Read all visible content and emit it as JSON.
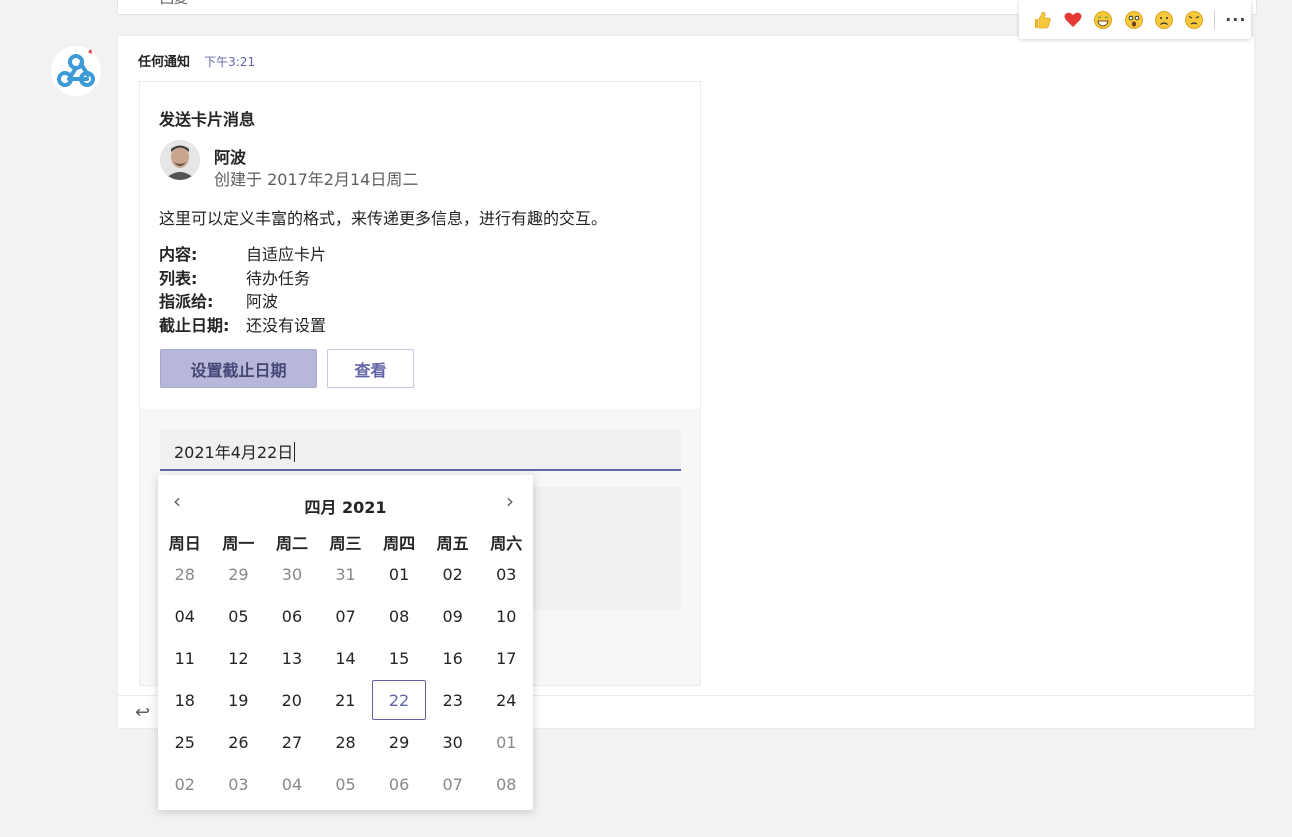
{
  "previous_message": {
    "text": "回复"
  },
  "message": {
    "sender": "任何通知",
    "time": "下午3:21"
  },
  "reactions": {
    "items": [
      "like-icon",
      "heart-icon",
      "laugh-icon",
      "surprised-icon",
      "sad-icon",
      "angry-icon"
    ],
    "more_label": "···"
  },
  "card": {
    "title": "发送卡片消息",
    "person": {
      "name": "阿波",
      "subtitle": "创建于 2017年2月14日周二"
    },
    "description": "这里可以定义丰富的格式，来传递更多信息，进行有趣的交互。",
    "facts": [
      {
        "key": "内容:",
        "value": "自适应卡片"
      },
      {
        "key": "列表:",
        "value": "待办任务"
      },
      {
        "key": "指派给:",
        "value": "阿波"
      },
      {
        "key": "截止日期:",
        "value": "还没有设置"
      }
    ],
    "buttons": {
      "set_due": "设置截止日期",
      "view": "查看"
    },
    "date_input": {
      "value": "2021年4月22日"
    }
  },
  "calendar": {
    "month_label": "四月 2021",
    "weekdays": [
      "周日",
      "周一",
      "周二",
      "周三",
      "周四",
      "周五",
      "周六"
    ],
    "selected": "22",
    "weeks": [
      [
        {
          "d": "28",
          "o": true
        },
        {
          "d": "29",
          "o": true
        },
        {
          "d": "30",
          "o": true
        },
        {
          "d": "31",
          "o": true
        },
        {
          "d": "01",
          "o": false
        },
        {
          "d": "02",
          "o": false
        },
        {
          "d": "03",
          "o": false
        }
      ],
      [
        {
          "d": "04",
          "o": false
        },
        {
          "d": "05",
          "o": false
        },
        {
          "d": "06",
          "o": false
        },
        {
          "d": "07",
          "o": false
        },
        {
          "d": "08",
          "o": false
        },
        {
          "d": "09",
          "o": false
        },
        {
          "d": "10",
          "o": false
        }
      ],
      [
        {
          "d": "11",
          "o": false
        },
        {
          "d": "12",
          "o": false
        },
        {
          "d": "13",
          "o": false
        },
        {
          "d": "14",
          "o": false
        },
        {
          "d": "15",
          "o": false
        },
        {
          "d": "16",
          "o": false
        },
        {
          "d": "17",
          "o": false
        }
      ],
      [
        {
          "d": "18",
          "o": false
        },
        {
          "d": "19",
          "o": false
        },
        {
          "d": "20",
          "o": false
        },
        {
          "d": "21",
          "o": false
        },
        {
          "d": "22",
          "o": false,
          "sel": true
        },
        {
          "d": "23",
          "o": false
        },
        {
          "d": "24",
          "o": false
        }
      ],
      [
        {
          "d": "25",
          "o": false
        },
        {
          "d": "26",
          "o": false
        },
        {
          "d": "27",
          "o": false
        },
        {
          "d": "28",
          "o": false
        },
        {
          "d": "29",
          "o": false
        },
        {
          "d": "30",
          "o": false
        },
        {
          "d": "01",
          "o": true
        }
      ],
      [
        {
          "d": "02",
          "o": true
        },
        {
          "d": "03",
          "o": true
        },
        {
          "d": "04",
          "o": true
        },
        {
          "d": "05",
          "o": true
        },
        {
          "d": "06",
          "o": true
        },
        {
          "d": "07",
          "o": true
        },
        {
          "d": "08",
          "o": true
        }
      ]
    ]
  }
}
